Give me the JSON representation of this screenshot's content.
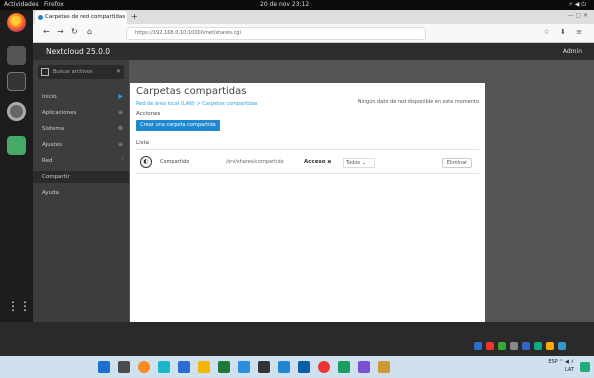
{
  "system": {
    "activities": "Actividades",
    "app_name": "Firefox",
    "clock": "20 de nov 23:12"
  },
  "browser": {
    "tab_title": "Carpetas de red compartidas",
    "url": "https://192.168.0.10:10000/net/shares.cgi",
    "window_controls": "— ▢ ✕"
  },
  "app": {
    "logo": "Nextcloud 25.0.0",
    "user": "Admin"
  },
  "sidebar": {
    "search_placeholder": "Buscar archivos",
    "items": [
      {
        "label": "Inicio"
      },
      {
        "label": "Aplicaciones"
      },
      {
        "label": "Sistema"
      },
      {
        "label": "Ajustes"
      },
      {
        "label": "Red"
      },
      {
        "label": "Compartir"
      },
      {
        "label": "Ayuda"
      }
    ]
  },
  "page": {
    "title": "Carpetas compartidas",
    "breadcrumb": "Red de área local (LAN) > Carpetas compartidas",
    "note": "Ningún dato de red disponible en este momento",
    "actions_label": "Acciones",
    "add_button": "Crear una carpeta compartida",
    "list_label": "Lista"
  },
  "shares": [
    {
      "name": "Compartido",
      "path": "/srv/shares/compartido",
      "access_label": "Acceso a",
      "access_value": "Todos"
    }
  ],
  "delete_label": "Eliminar"
}
